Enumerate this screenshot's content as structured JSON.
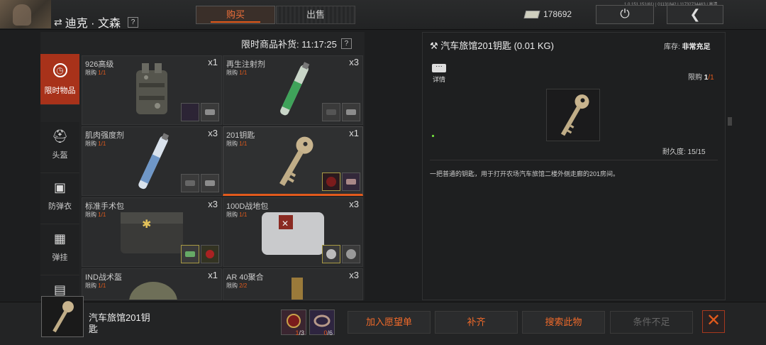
{
  "header": {
    "player_name": "迪克 · 文森",
    "help": "?",
    "tabs": [
      "购买",
      "出售"
    ],
    "money": "178692",
    "version": "1.0.151.151(61) | 01131842 | 11732734463 | 高清"
  },
  "shop": {
    "restock_label": "限时商品补货: 11:17:25",
    "categories": [
      {
        "label": "限时物品",
        "icon": "clock-icon"
      },
      {
        "label": "头盔",
        "icon": "helmet-icon"
      },
      {
        "label": "防弹衣",
        "icon": "vest-icon"
      },
      {
        "label": "弹挂",
        "icon": "rig-icon"
      }
    ],
    "limit_prefix": "限购",
    "items": [
      {
        "name": "926高级",
        "qty": "x1",
        "limit": "1/1"
      },
      {
        "name": "再生注射剂",
        "qty": "x3",
        "limit": "1/1"
      },
      {
        "name": "肌肉强度剂",
        "qty": "x3",
        "limit": "1/1"
      },
      {
        "name": "201钥匙",
        "qty": "x1",
        "limit": "1/1"
      },
      {
        "name": "标准手术包",
        "qty": "x3",
        "limit": "1/1"
      },
      {
        "name": "100D战地包",
        "qty": "x3",
        "limit": "1/1"
      },
      {
        "name": "IND战术盔",
        "qty": "x1",
        "limit": "1/1"
      },
      {
        "name": "AR 40聚合",
        "qty": "x3",
        "limit": "2/2"
      }
    ]
  },
  "detail": {
    "title": "汽车旅馆201钥匙 (0.01 KG)",
    "stock_label": "库存:",
    "stock_value": "非常充足",
    "info_label": "详情",
    "limit_label": "限购",
    "limit_value": "1",
    "limit_total": "/1",
    "durability": "耐久度: 15/15",
    "description": "一把普通的钥匙，用于打开农场汽车旅馆二楼外侧走廊的201房间。"
  },
  "bottom": {
    "item_name": "汽车旅馆201钥匙",
    "materials": [
      {
        "have": "1",
        "need": "/3"
      },
      {
        "have": "0",
        "need": "/6"
      }
    ],
    "buttons": {
      "wishlist": "加入愿望单",
      "fill": "补齐",
      "search": "搜索此物",
      "condition": "条件不足"
    }
  },
  "colors": {
    "accent": "#e25a1c",
    "bg": "#1d1e1f"
  }
}
